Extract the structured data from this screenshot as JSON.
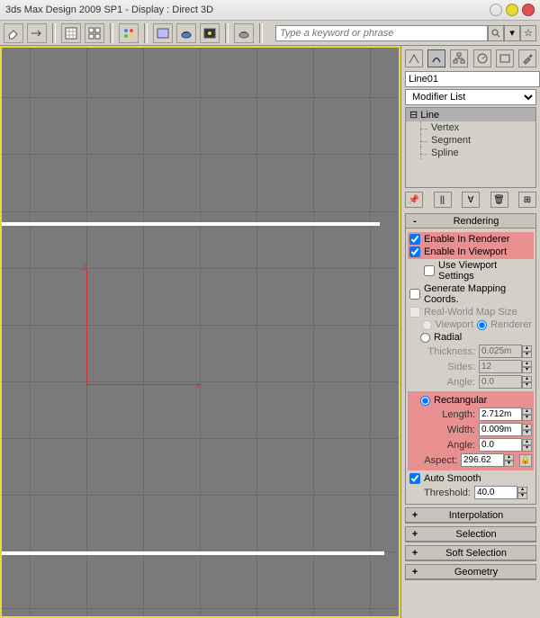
{
  "titlebar": {
    "title": "3ds Max Design 2009 SP1        - Display : Direct 3D",
    "btns": {
      "green": "#4fc94f",
      "yellow": "#e8d838",
      "red": "#e05050"
    }
  },
  "search": {
    "placeholder": "Type a keyword or phrase"
  },
  "object": {
    "name": "Line01"
  },
  "modifier_dropdown": "Modifier List",
  "stack": {
    "root": "Line",
    "subs": [
      "Vertex",
      "Segment",
      "Spline"
    ]
  },
  "rollouts": {
    "rendering": {
      "title": "Rendering",
      "enable_renderer": "Enable In Renderer",
      "enable_viewport": "Enable In Viewport",
      "use_viewport_settings": "Use Viewport Settings",
      "gen_mapping": "Generate Mapping Coords.",
      "real_world": "Real-World Map Size",
      "viewport": "Viewport",
      "renderer": "Renderer",
      "radial": "Radial",
      "thickness": {
        "label": "Thickness:",
        "value": "0.025m"
      },
      "sides": {
        "label": "Sides:",
        "value": "12"
      },
      "angle1": {
        "label": "Angle:",
        "value": "0.0"
      },
      "rectangular": "Rectangular",
      "length": {
        "label": "Length:",
        "value": "2.712m"
      },
      "width": {
        "label": "Width:",
        "value": "0.009m"
      },
      "angle2": {
        "label": "Angle:",
        "value": "0.0"
      },
      "aspect": {
        "label": "Aspect:",
        "value": "296.62"
      },
      "auto_smooth": "Auto Smooth",
      "threshold": {
        "label": "Threshold:",
        "value": "40.0"
      }
    },
    "collapsed": [
      "Interpolation",
      "Selection",
      "Soft Selection",
      "Geometry"
    ]
  },
  "chart_data": null
}
